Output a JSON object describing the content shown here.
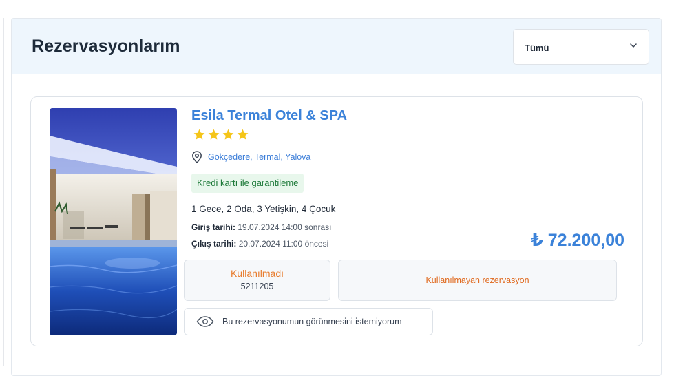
{
  "header": {
    "title": "Rezervasyonlarım",
    "filter": {
      "selected": "Tümü",
      "icon": "chevron-down-icon"
    }
  },
  "reservation": {
    "hotel_name": "Esila Termal Otel & SPA",
    "star_rating": 4,
    "location": "Gökçedere, Termal, Yalova",
    "guarantee": "Kredi kartı ile garantileme",
    "occupancy": "1 Gece, 2 Oda, 3 Yetişkin, 4 Çocuk",
    "checkin_label": "Giriş tarihi:",
    "checkin_value": "19.07.2024 14:00 sonrası",
    "checkout_label": "Çıkış tarihi:",
    "checkout_value": "20.07.2024 11:00 öncesi",
    "price": "₺ 72.200,00",
    "status": "Kullanılmadı",
    "reservation_number": "5211205",
    "status_info": "Kullanılmayan rezervasyon",
    "hide_label": "Bu rezervasyonumun görünmesini istemiyorum"
  },
  "colors": {
    "accent": "#3b82d9",
    "status_orange": "#e87d2f",
    "badge_bg": "#e8f7ec",
    "badge_text": "#1e7a3a",
    "header_bg": "#eef6fd",
    "star": "#f5c518"
  }
}
